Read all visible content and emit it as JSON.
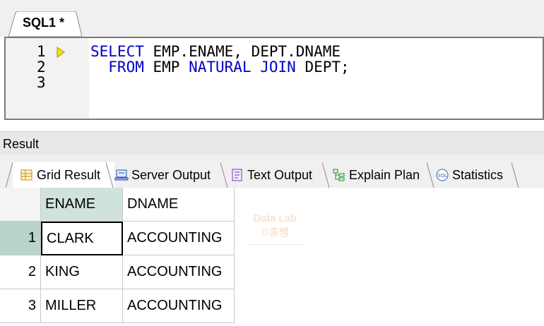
{
  "editor": {
    "tab_label": "SQL1 *",
    "line_numbers": [
      "1",
      "2",
      "3"
    ],
    "lines": [
      {
        "parts": [
          {
            "t": "SELECT",
            "k": true
          },
          {
            "t": " EMP.ENAME, DEPT.DNAME",
            "k": false
          }
        ]
      },
      {
        "parts": [
          {
            "t": "  FROM",
            "k": true
          },
          {
            "t": " EMP ",
            "k": false
          },
          {
            "t": "NATURAL JOIN",
            "k": true
          },
          {
            "t": " DEPT;",
            "k": false
          }
        ]
      },
      {
        "parts": []
      }
    ]
  },
  "result": {
    "title": "Result",
    "tabs": [
      {
        "label": "Grid Result",
        "icon": "grid-icon"
      },
      {
        "label": "Server Output",
        "icon": "server-output-icon"
      },
      {
        "label": "Text Output",
        "icon": "text-output-icon"
      },
      {
        "label": "Explain Plan",
        "icon": "explain-plan-icon"
      },
      {
        "label": "Statistics",
        "icon": "statistics-icon"
      }
    ]
  },
  "grid": {
    "columns": [
      "ENAME",
      "DNAME"
    ],
    "rows": [
      {
        "num": "1",
        "cells": [
          "CLARK",
          "ACCOUNTING"
        ]
      },
      {
        "num": "2",
        "cells": [
          "KING",
          "ACCOUNTING"
        ]
      },
      {
        "num": "3",
        "cells": [
          "MILLER",
          "ACCOUNTING"
        ]
      }
    ]
  },
  "watermark": {
    "line1": "Data Lab",
    "line2": "©홍쌤"
  },
  "colors": {
    "keyword": "#0000c8",
    "selection": "#cfe3dc",
    "marker": "#e8d200"
  }
}
